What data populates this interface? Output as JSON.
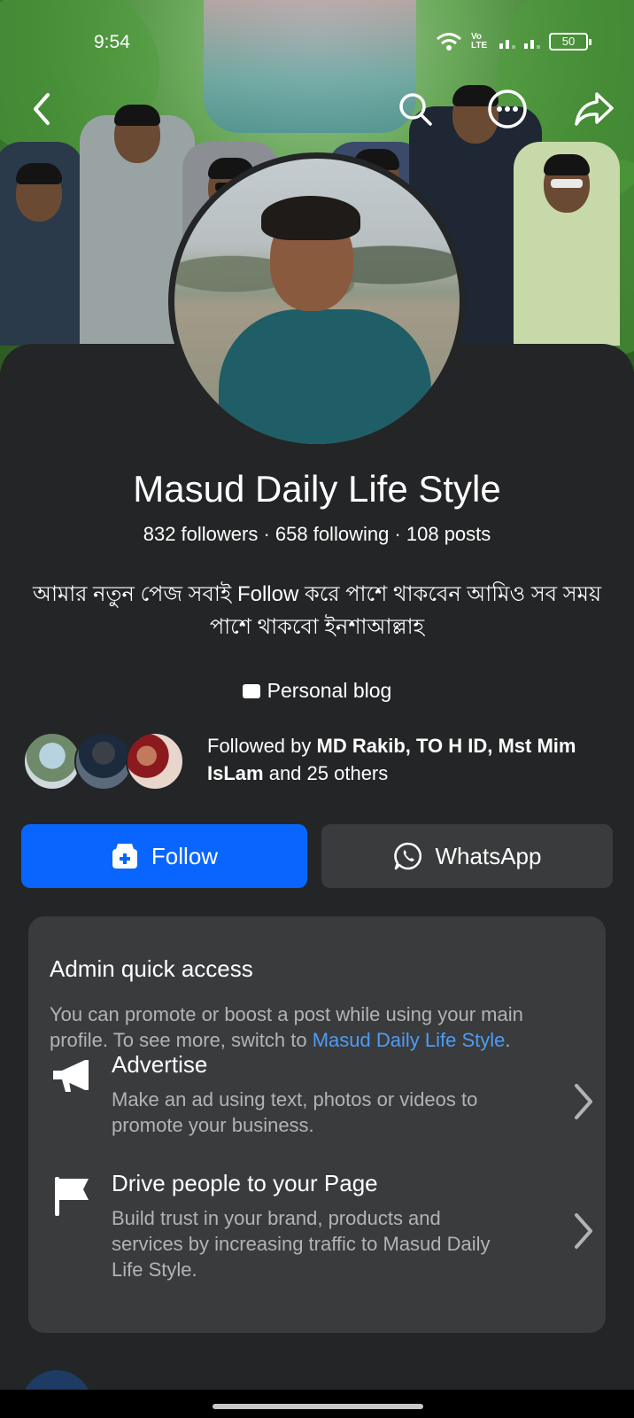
{
  "status": {
    "time": "9:54",
    "battery": "50",
    "network_label": "Vo LTE"
  },
  "profile": {
    "name": "Masud Daily Life Style",
    "stats": "832 followers · 658 following · 108 posts",
    "bio": "আমার  নতুন পেজ সবাই Follow  করে পাশে থাকবেন আমিও সব সময় পাশে থাকবো ইনশাআল্লাহ",
    "category": "Personal blog"
  },
  "followed_by": {
    "prefix": "Followed by ",
    "names": "MD Rakib, TO H ID, Mst Mim IsLam",
    "suffix": " and 25 others"
  },
  "buttons": {
    "follow_label": "Follow",
    "whatsapp_label": "WhatsApp"
  },
  "admin": {
    "title": "Admin quick access",
    "desc_prefix": "You can promote or boost a post while using your main profile. To see more, switch to ",
    "desc_link": "Masud Daily Life Style",
    "desc_suffix": ".",
    "items": [
      {
        "title": "Advertise",
        "desc": "Make an ad using text, photos or videos to promote your business.",
        "icon": "megaphone-icon"
      },
      {
        "title": "Drive people to your Page",
        "desc": "Build trust in your brand, products and services by increasing traffic to Masud Daily Life Style.",
        "icon": "flag-icon"
      }
    ]
  },
  "colors": {
    "primary": "#0866ff",
    "background": "#242526",
    "card": "#3a3b3c",
    "link": "#4e9cf5",
    "secondary_text": "#b0b3b8"
  }
}
